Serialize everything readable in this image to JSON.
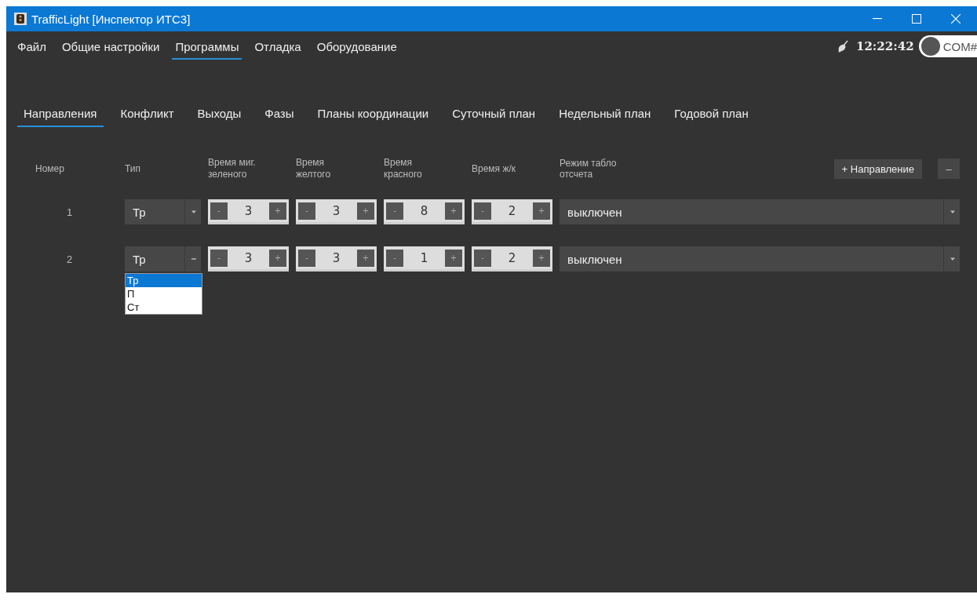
{
  "window": {
    "title": "TrafficLight [Инспектор ИТС3]"
  },
  "menu": [
    {
      "label": "Файл",
      "selected": false
    },
    {
      "label": "Общие настройки",
      "selected": false
    },
    {
      "label": "Программы",
      "selected": true
    },
    {
      "label": "Отладка",
      "selected": false
    },
    {
      "label": "Оборудование",
      "selected": false
    }
  ],
  "status": {
    "time": "12:22:42",
    "port": "COM#"
  },
  "tabs": [
    {
      "label": "Направления",
      "selected": true
    },
    {
      "label": "Конфликт",
      "selected": false
    },
    {
      "label": "Выходы",
      "selected": false
    },
    {
      "label": "Фазы",
      "selected": false
    },
    {
      "label": "Планы координации",
      "selected": false
    },
    {
      "label": "Суточный план",
      "selected": false
    },
    {
      "label": "Недельный план",
      "selected": false
    },
    {
      "label": "Годовой план",
      "selected": false
    }
  ],
  "table": {
    "columns": [
      "Номер",
      "Тип",
      "Время миг. зеленого",
      "Время желтого",
      "Время красного",
      "Время ж/к",
      "Режим табло отсчета"
    ],
    "add_button": "+ Направление",
    "remove_button": "–",
    "stepper": {
      "decrement": "-",
      "increment": "+"
    },
    "rows": [
      {
        "number": "1",
        "type": "Тр",
        "times": [
          "3",
          "3",
          "8",
          "2"
        ],
        "display_mode": "выключен",
        "expanded": false
      },
      {
        "number": "2",
        "type": "Тр",
        "times": [
          "3",
          "3",
          "1",
          "2"
        ],
        "display_mode": "выключен",
        "expanded": true
      }
    ]
  },
  "dropdown": {
    "options": [
      {
        "label": "Тр",
        "selected": true
      },
      {
        "label": "П",
        "selected": false
      },
      {
        "label": "Ст",
        "selected": false
      }
    ]
  }
}
